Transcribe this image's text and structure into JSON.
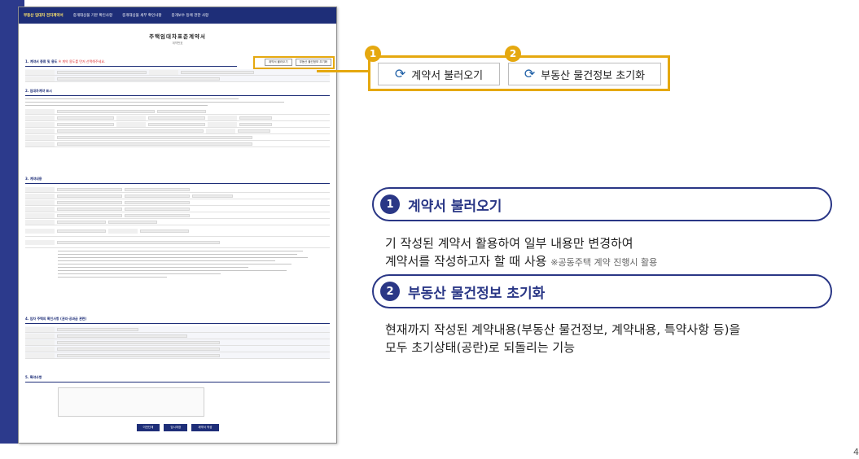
{
  "form": {
    "tabs": [
      "부동산 임대차 전자계약서",
      "중개대상물 기본 확인사항",
      "중개대상물 세부 확인사항",
      "중개보수 등에 관한 사항"
    ],
    "doc_title": "주택임대차표준계약서",
    "doc_sub": "계약번호",
    "mini_buttons": [
      "계약서 불러오기",
      "부동산 물건정보 초기화"
    ],
    "section1": "1. 계약서 종류 및 용도",
    "section1_note": "※ 계약 용도를 먼저 선택해주세요.",
    "section2": "2. 임대차계약 표시",
    "section3": "3. 계약내용",
    "section4": "4. 임차 주택의 확인사항 (권리·공과금 관련)",
    "section5": "5. 특약사항",
    "bottom_buttons": [
      "이전단계",
      "임시저장",
      "계약서 작성"
    ]
  },
  "zoom": {
    "badge_1": "1",
    "badge_2": "2",
    "button_1": "계약서 불러오기",
    "button_2": "부동산 물건정보 초기화"
  },
  "items": [
    {
      "number": "1",
      "title": "계약서 불러오기",
      "desc_line1": "기 작성된 계약서 활용하여 일부 내용만 변경하여",
      "desc_line2": "계약서를 작성하고자 할 때 사용",
      "note": "※공동주택 계약 진행시 활용"
    },
    {
      "number": "2",
      "title": "부동산 물건정보 초기화",
      "desc_line1": "현재까지 작성된 계약내용(부동산 물건정보, 계약내용, 특약사항 등)을",
      "desc_line2": "모두 초기상태(공란)로 되돌리는 기능"
    }
  ],
  "page_number": "4",
  "colors": {
    "navy": "#2a3786",
    "accent": "#e5a80f"
  }
}
